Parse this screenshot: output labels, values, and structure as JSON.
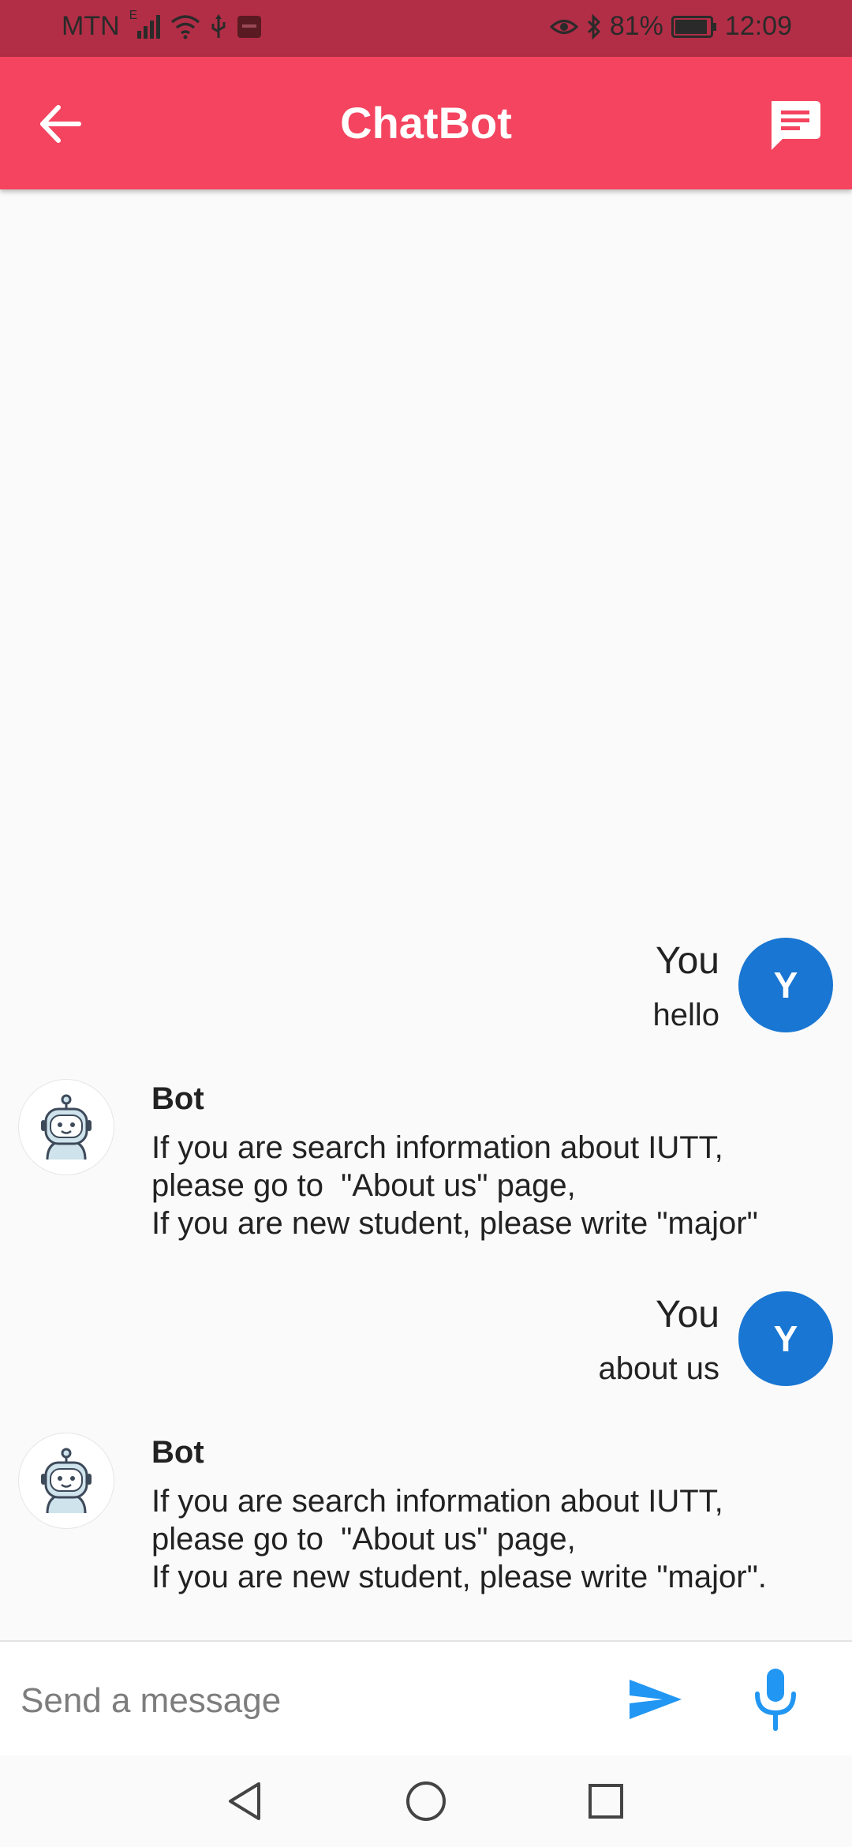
{
  "status_bar": {
    "carrier": "MTN",
    "network_badge": "E",
    "battery": "81%",
    "time": "12:09",
    "icons": [
      "signal-icon",
      "wifi-icon",
      "usb-icon",
      "notification-icon",
      "eye-icon",
      "bluetooth-icon",
      "battery-icon"
    ]
  },
  "app_bar": {
    "title": "ChatBot",
    "back_icon": "arrow-back-icon",
    "chat_icon": "chat-bubble-icon"
  },
  "messages": [
    {
      "sender": "user",
      "name": "You",
      "avatar_letter": "Y",
      "text": "hello"
    },
    {
      "sender": "bot",
      "name": "Bot",
      "lines": [
        "If you are search information about IUTT,",
        "please go to  \"About us\" page,",
        "If you are new student, please write \"major\""
      ]
    },
    {
      "sender": "user",
      "name": "You",
      "avatar_letter": "Y",
      "text": "about us"
    },
    {
      "sender": "bot",
      "name": "Bot",
      "lines": [
        "If you are search information about IUTT,",
        "please go to  \"About us\" page,",
        "If you are new student, please write \"major\"."
      ]
    }
  ],
  "composer": {
    "placeholder": "Send a message",
    "send_icon": "send-icon",
    "mic_icon": "microphone-icon"
  },
  "nav_bar": {
    "icons": [
      "back-triangle-icon",
      "home-circle-icon",
      "recents-square-icon"
    ]
  },
  "colors": {
    "status_bar": "#b22e46",
    "app_bar": "#f4445f",
    "user_avatar": "#1976d2",
    "accent_blue": "#2196f3",
    "background": "#fafafa"
  }
}
